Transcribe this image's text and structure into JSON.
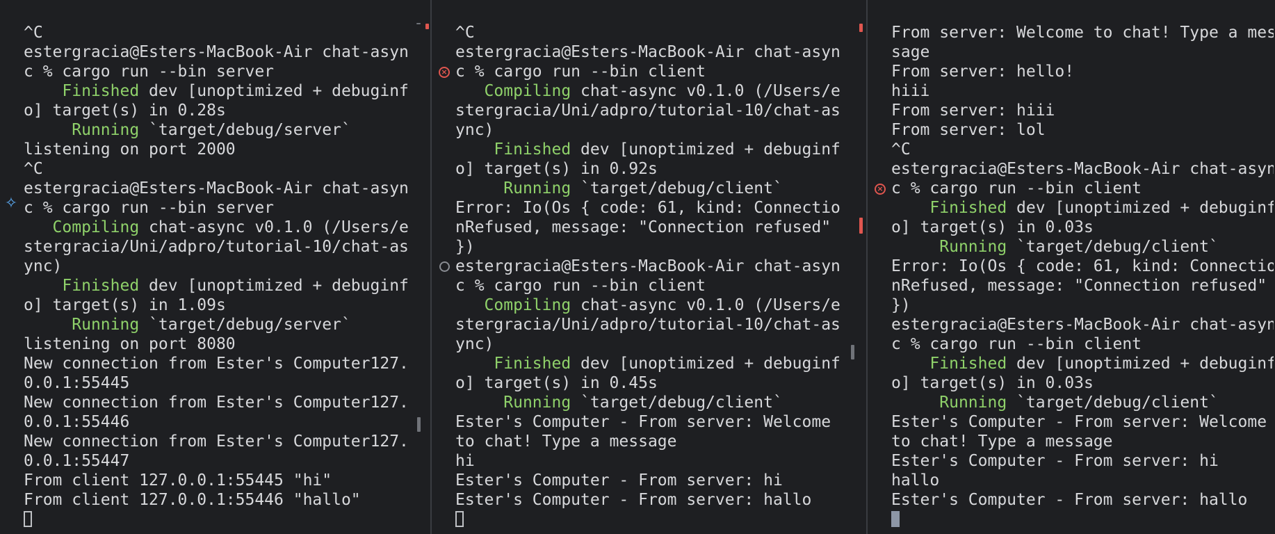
{
  "colors": {
    "background": "#1e1f22",
    "text": "#d7d8db",
    "highlight": "#8fd16a",
    "error": "#e0564f",
    "divider": "#3a3c41"
  },
  "panes": [
    {
      "id": "server",
      "lines": [
        "^C",
        "estergracia@Esters-MacBook-Air chat-asyn",
        "c % cargo run --bin server",
        "    Finished dev [unoptimized + debuginf",
        "o] target(s) in 0.28s",
        "     Running `target/debug/server`",
        "listening on port 2000",
        "^C",
        "estergracia@Esters-MacBook-Air chat-asyn",
        "c % cargo run --bin server",
        "   Compiling chat-async v0.1.0 (/Users/e",
        "stergracia/Uni/adpro/tutorial-10/chat-as",
        "ync)",
        "    Finished dev [unoptimized + debuginf",
        "o] target(s) in 1.09s",
        "     Running `target/debug/server`",
        "listening on port 8080",
        "New connection from Ester's Computer127.",
        "0.0.1:55445",
        "New connection from Ester's Computer127.",
        "0.0.1:55446",
        "New connection from Ester's Computer127.",
        "0.0.1:55447",
        "From client 127.0.0.1:55445 \"hi\"",
        "From client 127.0.0.1:55446 \"hallo\""
      ]
    },
    {
      "id": "client-1",
      "lines": [
        "^C",
        "estergracia@Esters-MacBook-Air chat-asyn",
        "c % cargo run --bin client",
        "   Compiling chat-async v0.1.0 (/Users/e",
        "stergracia/Uni/adpro/tutorial-10/chat-as",
        "ync)",
        "    Finished dev [unoptimized + debuginf",
        "o] target(s) in 0.92s",
        "     Running `target/debug/client`",
        "Error: Io(Os { code: 61, kind: Connectio",
        "nRefused, message: \"Connection refused\"",
        "})",
        "estergracia@Esters-MacBook-Air chat-asyn",
        "c % cargo run --bin client",
        "   Compiling chat-async v0.1.0 (/Users/e",
        "stergracia/Uni/adpro/tutorial-10/chat-as",
        "ync)",
        "    Finished dev [unoptimized + debuginf",
        "o] target(s) in 0.45s",
        "     Running `target/debug/client`",
        "Ester's Computer - From server: Welcome",
        "to chat! Type a message",
        "hi",
        "Ester's Computer - From server: hi",
        "Ester's Computer - From server: hallo"
      ]
    },
    {
      "id": "client-2",
      "lines": [
        "From server: Welcome to chat! Type a mes",
        "sage",
        "From server: hello!",
        "hiii",
        "From server: hiii",
        "From server: lol",
        "^C",
        "estergracia@Esters-MacBook-Air chat-asyn",
        "c % cargo run --bin client",
        "    Finished dev [unoptimized + debuginf",
        "o] target(s) in 0.03s",
        "     Running `target/debug/client`",
        "Error: Io(Os { code: 61, kind: Connectio",
        "nRefused, message: \"Connection refused\"",
        "})",
        "estergracia@Esters-MacBook-Air chat-asyn",
        "c % cargo run --bin client",
        "    Finished dev [unoptimized + debuginf",
        "o] target(s) in 0.03s",
        "     Running `target/debug/client`",
        "Ester's Computer - From server: Welcome",
        "to chat! Type a message",
        "Ester's Computer - From server: hi",
        "hallo",
        "Ester's Computer - From server: hallo"
      ]
    }
  ],
  "gutter": {
    "server": [
      {
        "line": 9,
        "icon": "sparkle-icon",
        "glyph": "✧"
      }
    ],
    "client-1": [
      {
        "line": 2,
        "icon": "error-status-icon",
        "glyph": "×"
      },
      {
        "line": 12,
        "icon": "idle-status-icon",
        "glyph": ""
      }
    ],
    "client-2": [
      {
        "line": 8,
        "icon": "error-status-icon",
        "glyph": "×"
      }
    ]
  }
}
